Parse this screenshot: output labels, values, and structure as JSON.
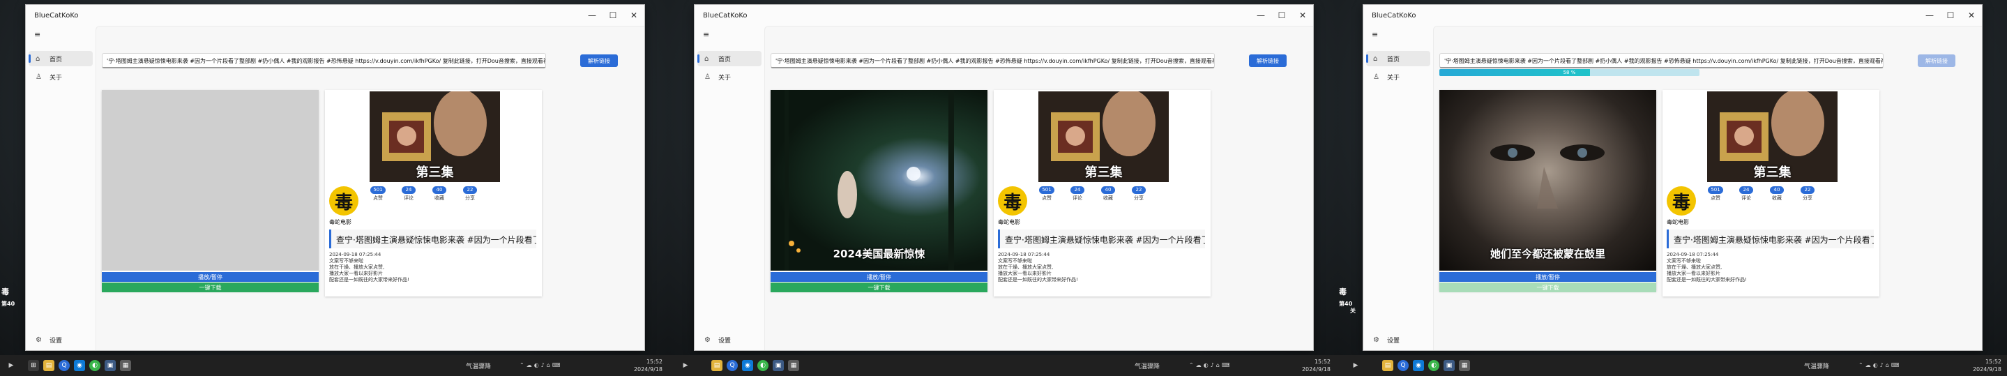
{
  "app": {
    "title": "BlueCatKoKo",
    "window_controls": [
      "—",
      "☐",
      "✕"
    ],
    "hamburger": "≡",
    "nav": {
      "home_label": "首页",
      "about_label": "关于",
      "settings_label": "设置"
    },
    "url_input_value": "'宁·塔图姆主演悬疑惊悚电影来袭 #因为一个片段看了整部剧 #扔小偶人 #我的观影报告 #恐怖悬疑  https://v.douyin.com/ikfhPGKo/ 复制此链接，打开Dou音搜索，直接观看视频!",
    "parse_button_label": "解析链接",
    "play_button_label": "播放/暂停",
    "download_button_label": "一键下载"
  },
  "video_info": {
    "cover_text": "第三集",
    "author_avatar_glyph": "毒",
    "author_name": "毒蛇电影",
    "stats": [
      {
        "value": "501",
        "label": "点赞"
      },
      {
        "value": "24",
        "label": "评论"
      },
      {
        "value": "40",
        "label": "收藏"
      },
      {
        "value": "22",
        "label": "分享"
      }
    ],
    "description": "查宁·塔图姆主演悬疑惊悚电影来袭 #因为一个片段看了整部剧",
    "meta_lines": [
      "2024-09-18 07:25:44",
      "文案写不够来啦",
      "放在干燥、播放大家点赞,",
      "播放大家一看以来好影片",
      "配套还是一如既往的大家带来好作品!"
    ]
  },
  "panels": [
    {
      "id": "empty",
      "left_side_texts": [
        "毒",
        "第40"
      ],
      "subtitle": "",
      "progress": null,
      "parse_disabled": false,
      "download_disabled": false
    },
    {
      "id": "forest",
      "left_side_texts": [],
      "subtitle": "2024美国最新惊悚",
      "progress": null,
      "parse_disabled": false,
      "download_disabled": false
    },
    {
      "id": "downloading",
      "left_side_texts": [
        "毒",
        "第40",
        "关"
      ],
      "subtitle": "她们至今都还被蒙在鼓里",
      "progress": {
        "value": 0.58,
        "label": "58 %"
      },
      "parse_disabled": true,
      "download_disabled": true
    }
  ],
  "taskbar": {
    "weather": "气温骤降",
    "time": "15:52",
    "date": "2024/9/18",
    "tray_icons": [
      "chevron-up-icon",
      "cloud-icon",
      "wechat-icon",
      "speaker-icon",
      "network-icon",
      "ime-icon"
    ],
    "pinned_icons": [
      "file-explorer-icon",
      "search-icon",
      "browser-icon",
      "edge-icon",
      "media-icon",
      "app-icon",
      "wechat-icon",
      "catkoko-icon",
      "bluecat-icon"
    ]
  },
  "colors": {
    "accent": "#2b6cd7",
    "download": "#2aa85d",
    "progress": "#27a9d6"
  }
}
